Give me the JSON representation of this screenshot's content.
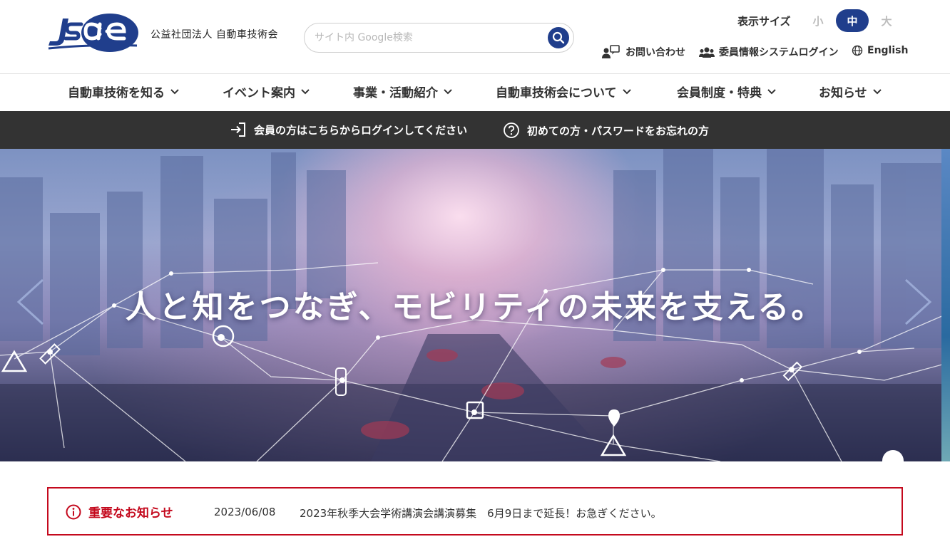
{
  "header": {
    "logo_text": "JSAE",
    "org_name": "公益社団法人 自動車技術会",
    "search_placeholder": "サイト内 Google検索",
    "font_size": {
      "label": "表示サイズ",
      "options": [
        "小",
        "中",
        "大"
      ],
      "selected": "中"
    },
    "links": {
      "contact": "お問い合わせ",
      "committee_login": "委員情報システムログイン",
      "english": "English"
    }
  },
  "nav": {
    "items": [
      "自動車技術を知る",
      "イベント案内",
      "事業・活動紹介",
      "自動車技術会について",
      "会員制度・特典",
      "お知らせ"
    ]
  },
  "login_bar": {
    "member_login": "会員の方はこちらからログインしてください",
    "first_time": "初めての方・パスワードをお忘れの方"
  },
  "hero": {
    "headline": "人と知をつなぎ、モビリティの未来を支える。"
  },
  "notice": {
    "heading": "重要なお知らせ",
    "date": "2023/06/08",
    "text": "2023年秋季大会学術講演会講演募集　6月9日まで延長！お急ぎください。"
  },
  "colors": {
    "brand_blue": "#203e8c",
    "notice_red": "#c4091d",
    "login_bar_bg": "#333333"
  }
}
